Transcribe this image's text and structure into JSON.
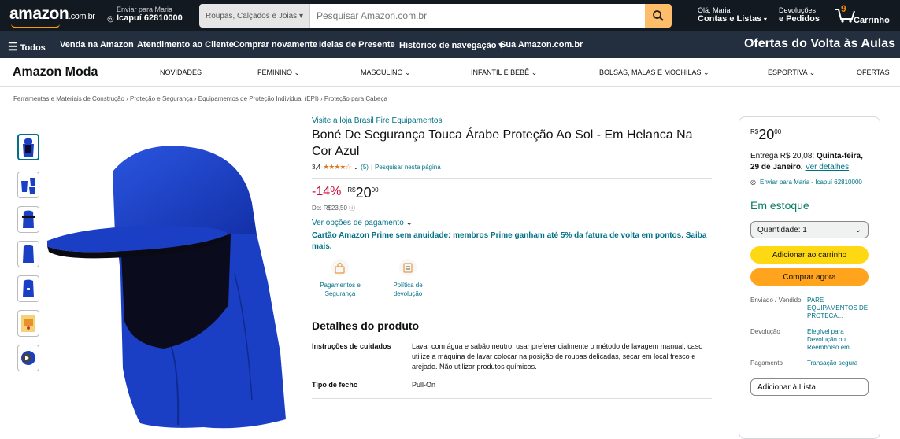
{
  "header": {
    "logo_text": "amazon",
    "logo_suffix": ".com.br",
    "deliver_line1": "Enviar para Maria",
    "deliver_line2": "Icapuí 62810000",
    "search_category": "Roupas, Calçados e Joias",
    "search_placeholder": "Pesquisar Amazon.com.br",
    "account_line1": "Olá, Maria",
    "account_line2": "Contas e Listas",
    "returns_line1": "Devoluções",
    "returns_line2": "e Pedidos",
    "cart_count": "9",
    "cart_label": "Carrinho"
  },
  "subnav": {
    "all": "Todos",
    "items": [
      "Venda na Amazon",
      "Atendimento ao Cliente",
      "Comprar novamente",
      "Ideias de Presente",
      "Histórico de navegação",
      "Sua Amazon.com.br"
    ],
    "promo": "Ofertas do Volta às Aulas"
  },
  "moda": {
    "brand": "Amazon Moda",
    "items": [
      "NOVIDADES",
      "FEMININO",
      "MASCULINO",
      "INFANTIL E BEBÊ",
      "BOLSAS, MALAS E MOCHILAS",
      "ESPORTIVA",
      "OFERTAS"
    ]
  },
  "breadcrumb": "Ferramentas e Materiais de Construção › Proteção e Segurança › Equipamentos de Proteção Individual (EPI) › Proteção para Cabeça",
  "product": {
    "store_link": "Visite a loja Brasil Fire Equipamentos",
    "title": "Boné De Segurança Touca Árabe Proteção Ao Sol - Em Helanca Na Cor Azul",
    "rating_value": "3,4",
    "rating_count": "(5)",
    "search_page": "Pesquisar nesta página",
    "discount": "-14%",
    "currency": "R$",
    "price_whole": "20",
    "price_cents": "00",
    "list_price_label": "De:",
    "list_price": "R$23,50",
    "payment_options": "Ver opções de pagamento",
    "prime_promo": "Cartão Amazon Prime sem anuidade: membros Prime ganham até 5% da fatura de volta em pontos. Saiba mais.",
    "features": [
      {
        "label": "Pagamentos e Segurança"
      },
      {
        "label": "Política de devolução"
      }
    ],
    "details_title": "Detalhes do produto",
    "details": [
      {
        "key": "Instruções de cuidados",
        "value": "Lavar com água e sabão neutro, usar preferencialmente o método de lavagem manual, caso utilize a máquina de lavar colocar na posição de roupas delicadas, secar em local fresco e arejado. Não utilizar produtos químicos."
      },
      {
        "key": "Tipo de fecho",
        "value": "Pull-On"
      }
    ]
  },
  "buybox": {
    "currency": "R$",
    "price_whole": "20",
    "price_cents": "00",
    "delivery_prefix": "Entrega R$ 20,08:",
    "delivery_date": "Quinta-feira, 29 de Janeiro.",
    "delivery_link": "Ver detalhes",
    "location": "Enviar para Maria - Icapuí 62810000",
    "stock": "Em estoque",
    "quantity": "Quantidade: 1",
    "add_to_cart": "Adicionar ao carrinho",
    "buy_now": "Comprar agora",
    "info": [
      {
        "key": "Enviado / Vendido",
        "value": "PARE EQUIPAMENTOS DE PROTECA..."
      },
      {
        "key": "Devolução",
        "value": "Elegível para Devolução ou Reembolso em..."
      },
      {
        "key": "Pagamento",
        "value": "Transação segura"
      }
    ],
    "add_to_list": "Adicionar à Lista"
  },
  "colors": {
    "nav_dark": "#131921",
    "nav_secondary": "#232f3e",
    "accent_orange": "#ff9900",
    "link": "#007185",
    "deal_red": "#cc0c39",
    "stock_green": "#067d62",
    "cart_button": "#ffd814",
    "buy_button": "#ffa41c",
    "product_blue": "#1a3fc4"
  }
}
